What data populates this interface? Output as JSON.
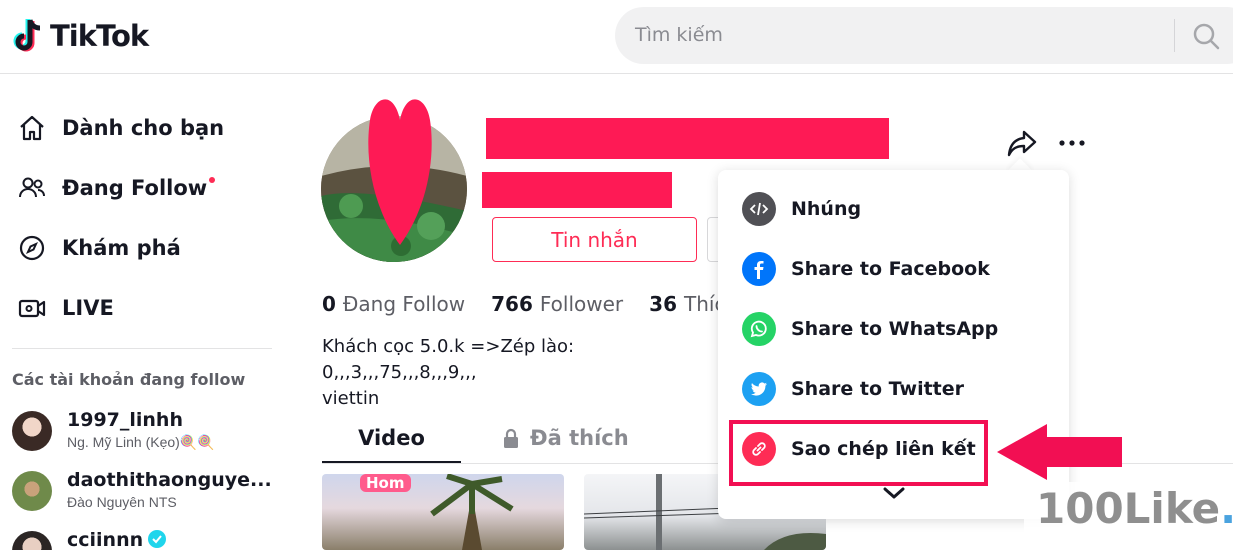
{
  "header": {
    "logo_text": "TikTok",
    "search_placeholder": "Tìm kiếm"
  },
  "sidebar": {
    "nav": [
      {
        "label": "Dành cho bạn",
        "icon": "home-icon"
      },
      {
        "label": "Đang Follow",
        "icon": "users-icon",
        "has_dot": true
      },
      {
        "label": "Khám phá",
        "icon": "compass-icon"
      },
      {
        "label": "LIVE",
        "icon": "live-video-icon"
      }
    ],
    "following_title": "Các tài khoản đang follow",
    "accounts": [
      {
        "name": "1997_linhh",
        "sub": "Ng. Mỹ Linh (Kẹo)🍭🍭"
      },
      {
        "name": "daothithaonguye...",
        "sub": "Đào Nguyên NTS"
      },
      {
        "name": "cciinnn",
        "sub": "",
        "verified": true
      }
    ]
  },
  "profile": {
    "message_button": "Tin nhắn",
    "stats": [
      {
        "num": "0",
        "label": "Đang Follow"
      },
      {
        "num": "766",
        "label": "Follower"
      },
      {
        "num": "36",
        "label": "Thích"
      }
    ],
    "bio_line1": "Khách cọc 5.0.k =>Zép lào: 0,,,3,,,75,,,8,,,9,,,",
    "bio_line2": "viettin"
  },
  "tabs": {
    "video": "Video",
    "liked": "Đã thích"
  },
  "thumb1_sticker": "Hom",
  "share_menu": {
    "items": [
      {
        "label": "Nhúng",
        "icon": "embed-icon",
        "color": "#505055"
      },
      {
        "label": "Share to Facebook",
        "icon": "facebook-icon",
        "color": "#0075fa"
      },
      {
        "label": "Share to WhatsApp",
        "icon": "whatsapp-icon",
        "color": "#25d366"
      },
      {
        "label": "Share to Twitter",
        "icon": "twitter-icon",
        "color": "#1da1f2"
      },
      {
        "label": "Sao chép liên kết",
        "icon": "link-icon",
        "color": "#fe2c55"
      }
    ]
  },
  "watermark": {
    "text": "100Like",
    "dot": "."
  },
  "colors": {
    "accent": "#fe2c55",
    "redaction": "#fe1a55"
  }
}
